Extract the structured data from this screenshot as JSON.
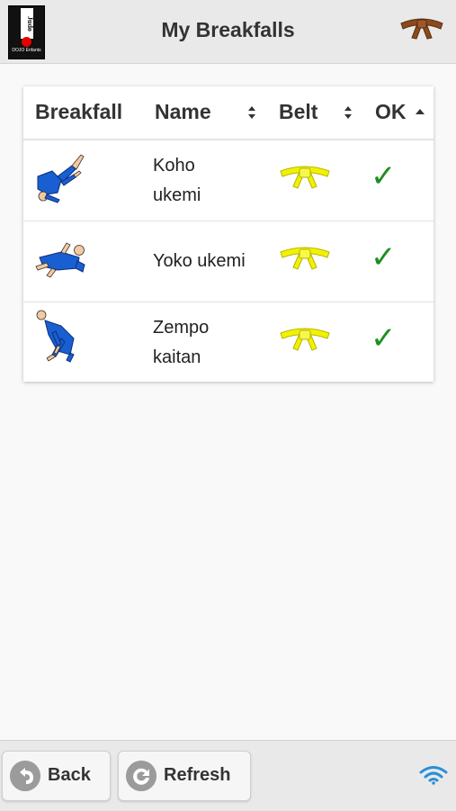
{
  "header": {
    "title": "My Breakfalls",
    "logo_text": "Judo",
    "logo_sub": "DOJO Enfants",
    "belt_icon": "brown-belt-icon"
  },
  "table": {
    "columns": [
      {
        "label": "Breakfall",
        "sortable": false
      },
      {
        "label": "Name",
        "sortable": true
      },
      {
        "label": "Belt",
        "sortable": true
      },
      {
        "label": "OK",
        "sort": "ascending"
      }
    ],
    "rows": [
      {
        "name": "Koho ukemi",
        "name_lines": [
          "Koho",
          "ukemi"
        ],
        "belt": "yellow",
        "ok": "✓",
        "figure": "koho-ukemi-figure-icon"
      },
      {
        "name": "Yoko ukemi",
        "name_lines": [
          "Yoko ukemi"
        ],
        "belt": "yellow",
        "ok": "✓",
        "figure": "yoko-ukemi-figure-icon"
      },
      {
        "name": "Zempo kaitan",
        "name_lines": [
          "Zempo",
          "kaitan"
        ],
        "belt": "yellow",
        "ok": "✓",
        "figure": "zempo-kaitan-figure-icon"
      }
    ]
  },
  "footer": {
    "back_label": "Back",
    "refresh_label": "Refresh",
    "wifi_icon": "wifi-icon"
  },
  "colors": {
    "header_bg": "#e9e9e9",
    "check_green": "#1f8f1f",
    "belt_yellow": "#f2f200",
    "belt_brown": "#8a4a1c",
    "judoka_blue": "#1a5fd1"
  }
}
